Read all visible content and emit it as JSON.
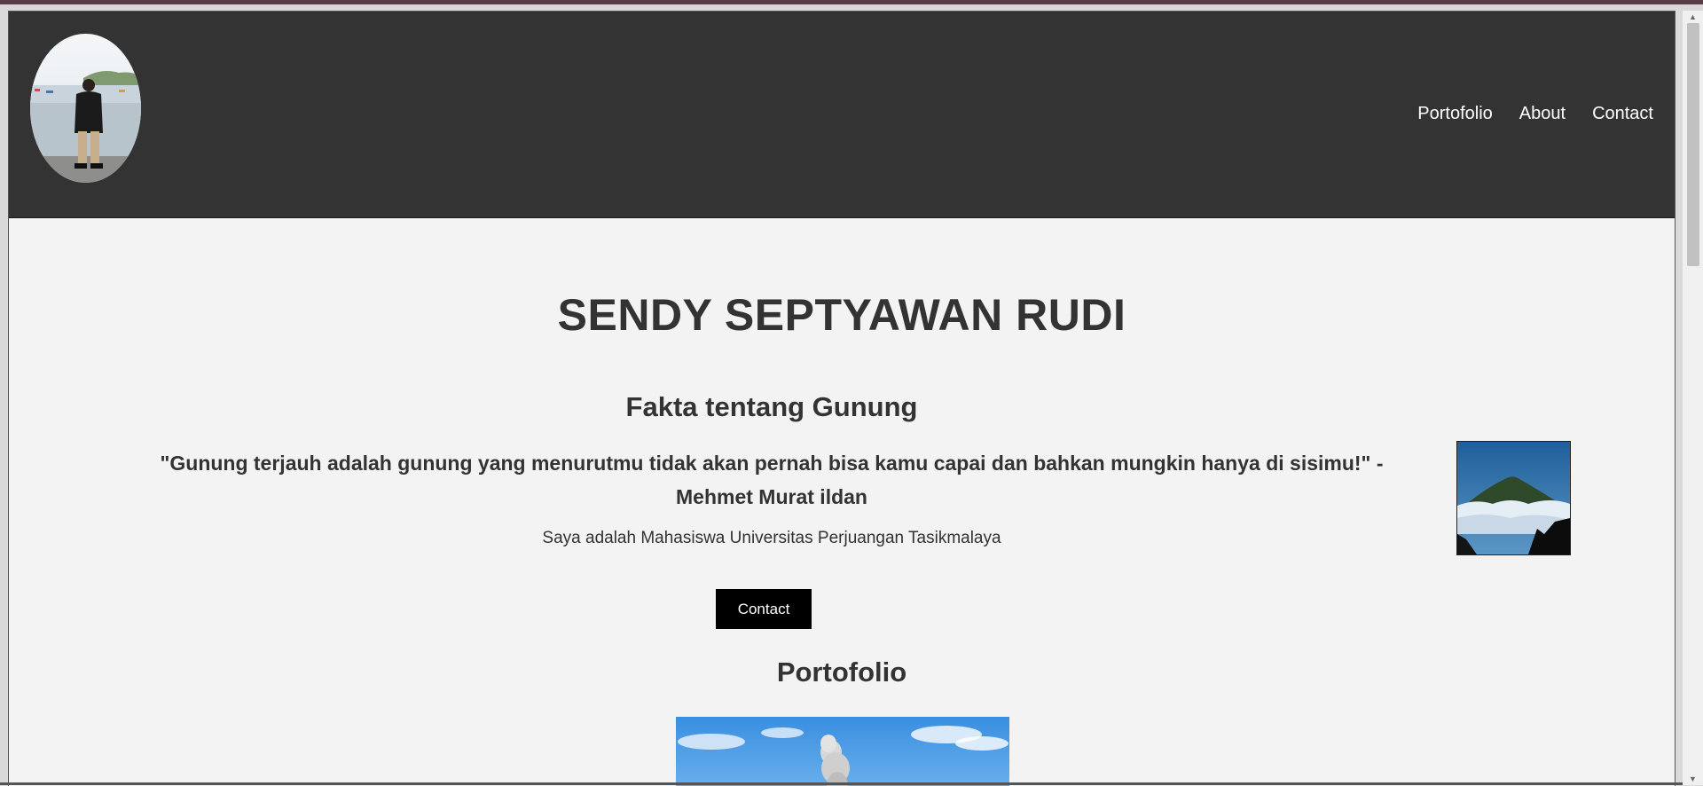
{
  "header": {
    "nav": [
      "Portofolio",
      "About",
      "Contact"
    ]
  },
  "hero": {
    "name": "SENDY SEPTYAWAN RUDI"
  },
  "about": {
    "title": "Fakta tentang Gunung",
    "quote": "\"Gunung terjauh adalah gunung yang menurutmu tidak akan pernah bisa kamu capai dan bahkan mungkin hanya di sisimu!\" - Mehmet Murat ildan",
    "description": "Saya adalah Mahasiswa Universitas Perjuangan Tasikmalaya",
    "contact_button": "Contact"
  },
  "portfolio": {
    "title": "Portofolio"
  },
  "colors": {
    "header_bg": "#333333",
    "page_bg": "#f3f3f3",
    "button_bg": "#000000",
    "text": "#333333"
  },
  "icons": {
    "scroll_up": "triangle-up-icon",
    "scroll_down": "triangle-down-icon"
  }
}
